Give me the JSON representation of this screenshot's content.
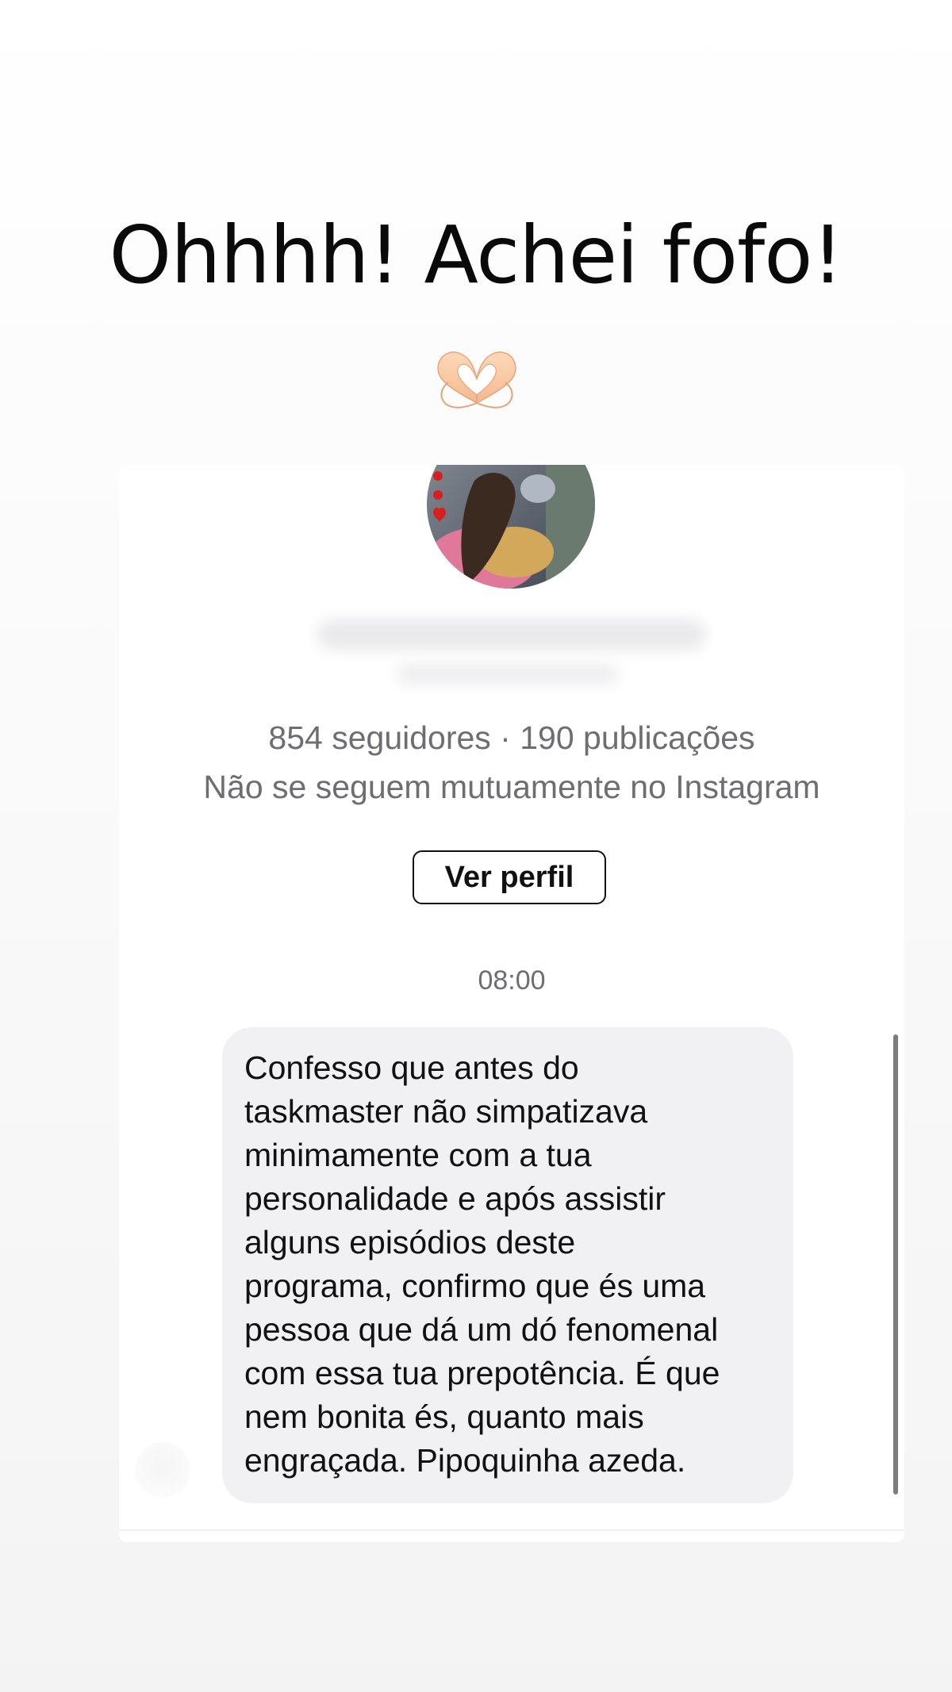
{
  "story": {
    "title": "Ohhhh! Achei fofo!",
    "sticker_icon": "heart-hands-emoji"
  },
  "profile_card": {
    "avatar_icon": "profile-photo",
    "name_blurred": true,
    "stats": "854 seguidores · 190 publicações",
    "mutual_text": "Não se seguem mutuamente no Instagram",
    "view_profile_label": "Ver perfil"
  },
  "conversation": {
    "timestamp": "08:00",
    "message_lines": [
      "Confesso que antes do",
      "taskmaster não simpatizava",
      "minimamente com a tua",
      "personalidade e após assistir",
      "alguns episódios deste",
      "programa, confirmo que és uma",
      "pessoa que dá um dó fenomenal",
      "com essa tua prepotência. É que",
      "nem bonita és, quanto mais",
      "engraçada. Pipoquinha azeda."
    ]
  },
  "colors": {
    "bubble_bg": "#f1f1f3",
    "secondary_text": "#6d6d72",
    "primary_text": "#111111"
  }
}
